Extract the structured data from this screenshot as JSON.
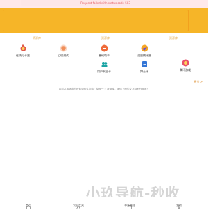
{
  "banner": {
    "error_text": "Request failed with status code 503"
  },
  "sections": {
    "left_tag": "资源库",
    "center_tag": "资源库",
    "right_tag": "资源库"
  },
  "tools": [
    {
      "label": "在线打卡器",
      "icon": "medal-icon",
      "color": "#e05a4b"
    },
    {
      "label": "心理测试",
      "icon": "heart-circle-icon",
      "color": "#f08f5a"
    },
    {
      "label": "基础助手",
      "icon": "orange-circle-icon",
      "color": "#ef6b3a"
    },
    {
      "label": "流量统计器",
      "icon": "rocket-icon",
      "color": "#f5a623"
    },
    {
      "label": "腾讯游戏",
      "icon": "gamepad-icon",
      "color": "#e9506b"
    },
    {
      "label": "用户安全卡",
      "icon": "users-icon",
      "color": "#1aa4a4"
    },
    {
      "label": "博士计",
      "icon": "document-icon",
      "color": "#3476d6"
    }
  ],
  "more": {
    "label": "更多 >"
  },
  "notice": {
    "text": "以前发展请求的时候请你注意哈！整理一下 数据库，请你下面的文字特别作用哈！"
  },
  "watermark": {
    "text": "小玖导航-秒收"
  },
  "nav": [
    {
      "label": "首页",
      "icon": "home-icon"
    },
    {
      "label": "发现工具",
      "icon": "triangle-icon"
    },
    {
      "label": "书签管理",
      "icon": "square-icon"
    },
    {
      "label": "我的",
      "icon": "user-icon"
    }
  ]
}
